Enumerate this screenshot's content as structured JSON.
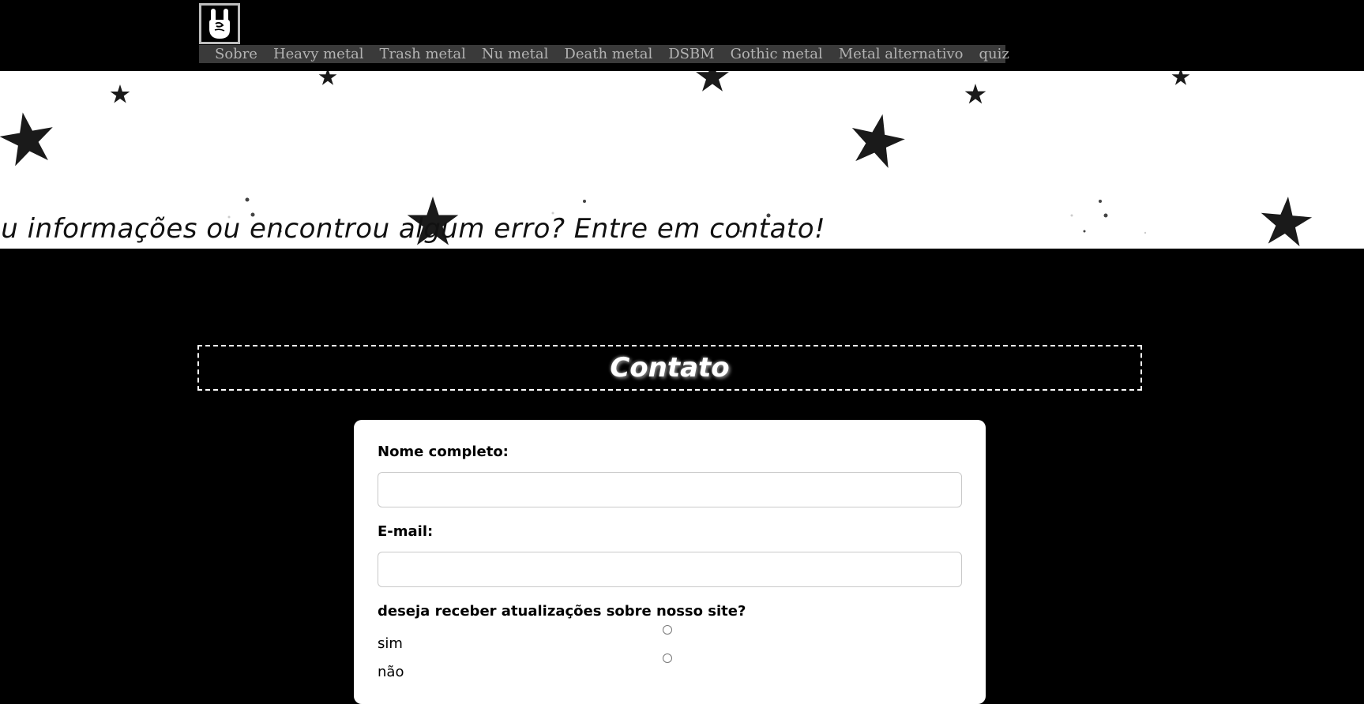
{
  "nav": {
    "logo_icon": "rock-hand-icon",
    "items": [
      "Sobre",
      "Heavy metal",
      "Trash metal",
      "Nu metal",
      "Death metal",
      "DSBM",
      "Gothic metal",
      "Metal alternativo",
      "quiz"
    ]
  },
  "banner": {
    "marquee_text": "ou informações ou encontrou algum erro? Entre em contato!"
  },
  "contact": {
    "title": "Contato"
  },
  "form": {
    "name_label": "Nome completo:",
    "name_value": "",
    "email_label": "E-mail:",
    "email_value": "",
    "updates_question": "deseja receber atualizações sobre nosso site?",
    "option_yes": "sim",
    "option_no": "não"
  },
  "colors": {
    "page_bg": "#000000",
    "nav_bg": "#3a3a3a",
    "nav_text": "#b3b3b3",
    "card_bg": "#ffffff"
  }
}
